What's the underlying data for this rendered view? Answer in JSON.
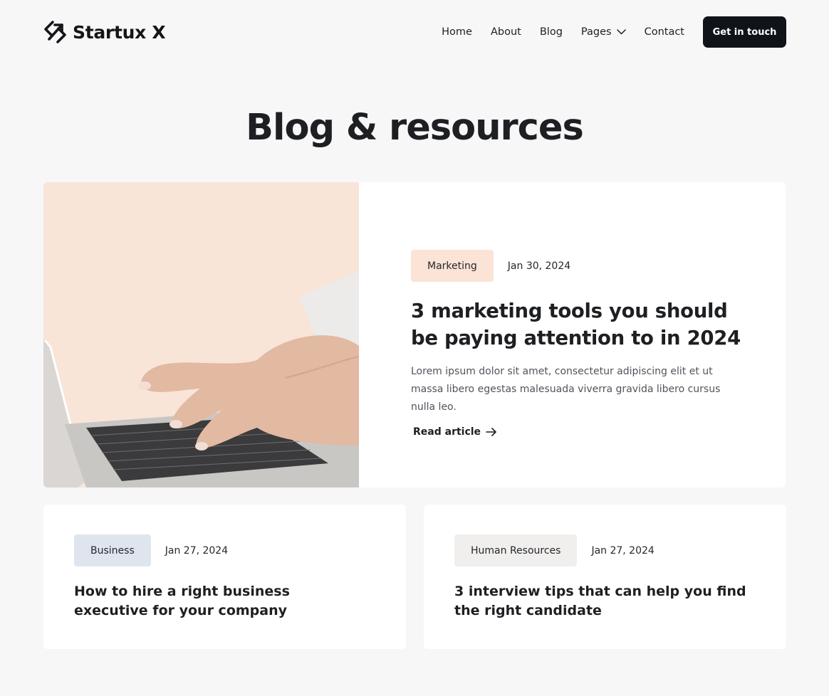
{
  "brand": {
    "name": "Startux X",
    "logo_icon": "startux-logo-icon"
  },
  "nav": {
    "items": [
      {
        "label": "Home"
      },
      {
        "label": "About"
      },
      {
        "label": "Blog"
      },
      {
        "label": "Pages",
        "icon": "chevron-down-icon"
      },
      {
        "label": "Contact"
      }
    ],
    "cta_label": "Get in touch"
  },
  "page": {
    "title": "Blog & resources"
  },
  "featured": {
    "image": "hands-typing-on-laptop",
    "tag": "Marketing",
    "date": "Jan 30, 2024",
    "title": "3 marketing tools you should be paying attention to in 2024",
    "excerpt": "Lorem ipsum dolor sit amet, consectetur adipiscing elit et ut massa libero egestas malesuada viverra gravida libero cursus nulla leo.",
    "link_label": "Read article",
    "link_icon": "arrow-right-icon"
  },
  "posts": [
    {
      "tag": "Business",
      "date": "Jan 27, 2024",
      "title": "How to hire a right business executive for your company"
    },
    {
      "tag": "Human Resources",
      "date": "Jan 27, 2024",
      "title": "3 interview tips that can help you find the right candidate"
    }
  ],
  "colors": {
    "background": "#f7f7f8",
    "button": "#10131a",
    "tag_marketing": "#fbe3d6",
    "tag_business": "#dfe5ee",
    "tag_hr": "#f0efed",
    "image_background": "#f9e4d8"
  }
}
